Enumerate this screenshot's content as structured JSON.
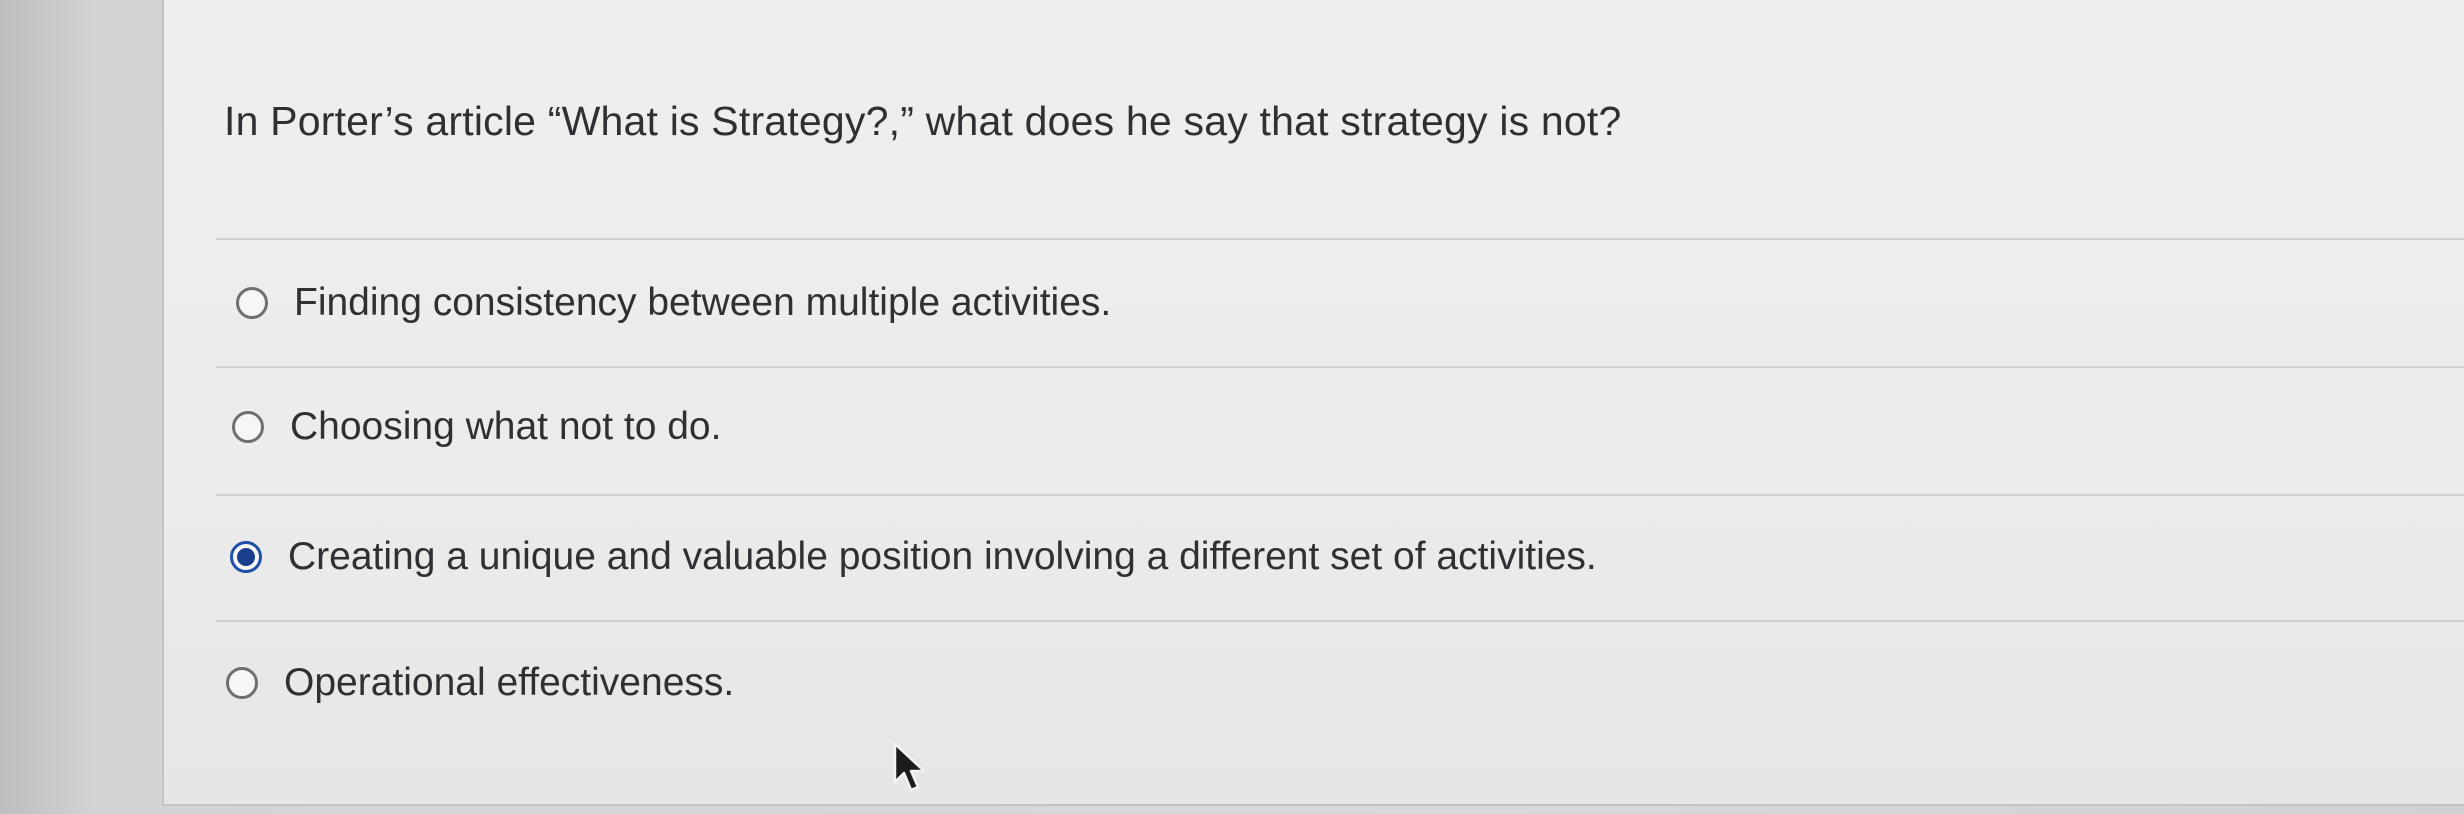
{
  "question": {
    "text": "In Porter’s article “What is Strategy?,” what does he say that strategy is not?"
  },
  "answers": [
    {
      "label": "Finding consistency between multiple activities.",
      "selected": false
    },
    {
      "label": "Choosing what not to do.",
      "selected": false
    },
    {
      "label": "Creating a unique and valuable position involving a different set of activities.",
      "selected": true
    },
    {
      "label": "Operational effectiveness.",
      "selected": false
    }
  ],
  "icons": {
    "cursor": "mouse-pointer-icon"
  },
  "colors": {
    "selected_radio": "#1a3f8f",
    "text": "#2f3033"
  }
}
